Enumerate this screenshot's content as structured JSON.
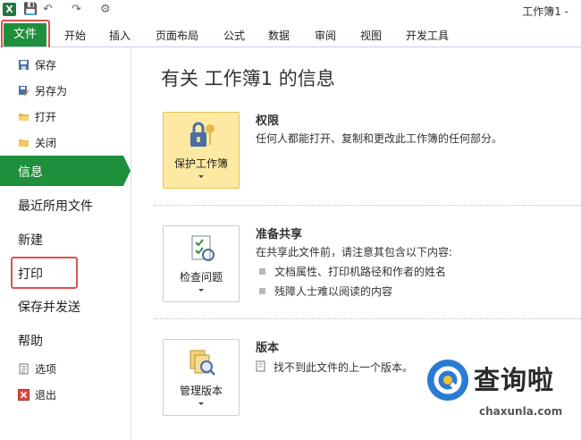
{
  "app": {
    "window_title": "工作簿1  -"
  },
  "ribbon": {
    "file_tab": "文件",
    "tabs": [
      "开始",
      "插入",
      "页面布局",
      "公式",
      "数据",
      "审阅",
      "视图",
      "开发工具"
    ]
  },
  "sidebar": {
    "small_items": [
      {
        "label": "保存",
        "icon": "save-icon"
      },
      {
        "label": "另存为",
        "icon": "save-as-icon"
      },
      {
        "label": "打开",
        "icon": "open-folder-icon"
      },
      {
        "label": "关闭",
        "icon": "close-folder-icon"
      }
    ],
    "active": "信息",
    "big_items": [
      "最近所用文件",
      "新建",
      "打印",
      "保存并发送",
      "帮助"
    ],
    "bottom_items": [
      {
        "label": "选项",
        "icon": "options-icon"
      },
      {
        "label": "退出",
        "icon": "exit-icon"
      }
    ]
  },
  "main": {
    "title": "有关 工作簿1 的信息",
    "sections": [
      {
        "button": "保护工作簿",
        "heading": "权限",
        "text": "任何人都能打开、复制和更改此工作簿的任何部分。"
      },
      {
        "button": "检查问题",
        "heading": "准备共享",
        "text": "在共享此文件前，请注意其包含以下内容:",
        "bullets": [
          "文档属性、打印机路径和作者的姓名",
          "残障人士难以阅读的内容"
        ]
      },
      {
        "button": "管理版本",
        "heading": "版本",
        "text": "找不到此文件的上一个版本。"
      }
    ]
  },
  "watermark": {
    "text": "查询啦",
    "url": "chaxunla.com"
  },
  "colors": {
    "file_green": "#1e8f3a",
    "highlight_red": "#d9534f",
    "protect_yellow": "#fde9a2"
  }
}
